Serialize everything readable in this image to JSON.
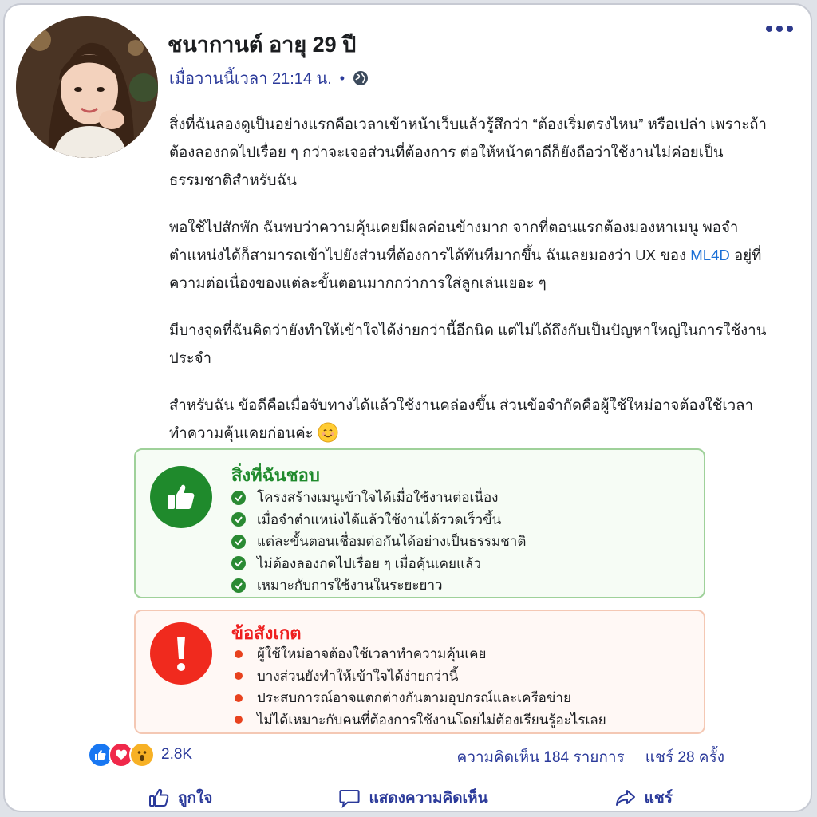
{
  "post": {
    "author": "ชนากานต์ อายุ 29 ปี",
    "timestamp": "เมื่อวานนี้เวลา 21:14 น.",
    "privacy_icon": "globe-icon",
    "more_icon": "more-options-icon",
    "paragraphs": {
      "p1": "สิ่งที่ฉันลองดูเป็นอย่างแรกคือเวลาเข้าหน้าเว็บแล้วรู้สึกว่า “ต้องเริ่มตรงไหน” หรือเปล่า เพราะถ้าต้องลองกดไปเรื่อย ๆ กว่าจะเจอส่วนที่ต้องการ ต่อให้หน้าตาดีก็ยังถือว่าใช้งานไม่ค่อยเป็นธรรมชาติสำหรับฉัน",
      "p2_before": "พอใช้ไปสักพัก ฉันพบว่าความคุ้นเคยมีผลค่อนข้างมาก จากที่ตอนแรกต้องมองหาเมนู พอจำตำแหน่งได้ก็สามารถเข้าไปยังส่วนที่ต้องการได้ทันทีมากขึ้น ฉันเลยมองว่า UX ของ ",
      "p2_link": "ML4D",
      "p2_after": " อยู่ที่ความต่อเนื่องของแต่ละขั้นตอนมากกว่าการใส่ลูกเล่นเยอะ ๆ",
      "p3": "มีบางจุดที่ฉันคิดว่ายังทำให้เข้าใจได้ง่ายกว่านี้อีกนิด แต่ไม่ได้ถึงกับเป็นปัญหาใหญ่ในการใช้งานประจำ",
      "p4": "สำหรับฉัน ข้อดีคือเมื่อจับทางได้แล้วใช้งานคล่องขึ้น ส่วนข้อจำกัดคือผู้ใช้ใหม่อาจต้องใช้เวลาทำความคุ้นเคยก่อนค่ะ",
      "p4_emoji": "smiling-face-icon"
    }
  },
  "likes_box": {
    "title": "สิ่งที่ฉันชอบ",
    "icon": "thumbs-up-icon",
    "items": [
      "โครงสร้างเมนูเข้าใจได้เมื่อใช้งานต่อเนื่อง",
      "เมื่อจำตำแหน่งได้แล้วใช้งานได้รวดเร็วขึ้น",
      "แต่ละขั้นตอนเชื่อมต่อกันได้อย่างเป็นธรรมชาติ",
      "ไม่ต้องลองกดไปเรื่อย ๆ เมื่อคุ้นเคยแล้ว",
      "เหมาะกับการใช้งานในระยะยาว"
    ]
  },
  "notes_box": {
    "title": "ข้อสังเกต",
    "icon": "exclamation-icon",
    "items": [
      "ผู้ใช้ใหม่อาจต้องใช้เวลาทำความคุ้นเคย",
      "บางส่วนยังทำให้เข้าใจได้ง่ายกว่านี้",
      "ประสบการณ์อาจแตกต่างกันตามอุปกรณ์และเครือข่าย",
      "ไม่ได้เหมาะกับคนที่ต้องการใช้งานโดยไม่ต้องเรียนรู้อะไรเลย"
    ]
  },
  "engagement": {
    "reaction_count": "2.8K",
    "comments": "ความคิดเห็น 184 รายการ",
    "shares": "แชร์ 28 ครั้ง"
  },
  "actions": {
    "like": "ถูกใจ",
    "comment": "แสดงความคิดเห็น",
    "share": "แชร์"
  },
  "colors": {
    "accent_blue": "#2b3a9a",
    "green": "#1f8a2c",
    "red": "#ee1f1f"
  }
}
